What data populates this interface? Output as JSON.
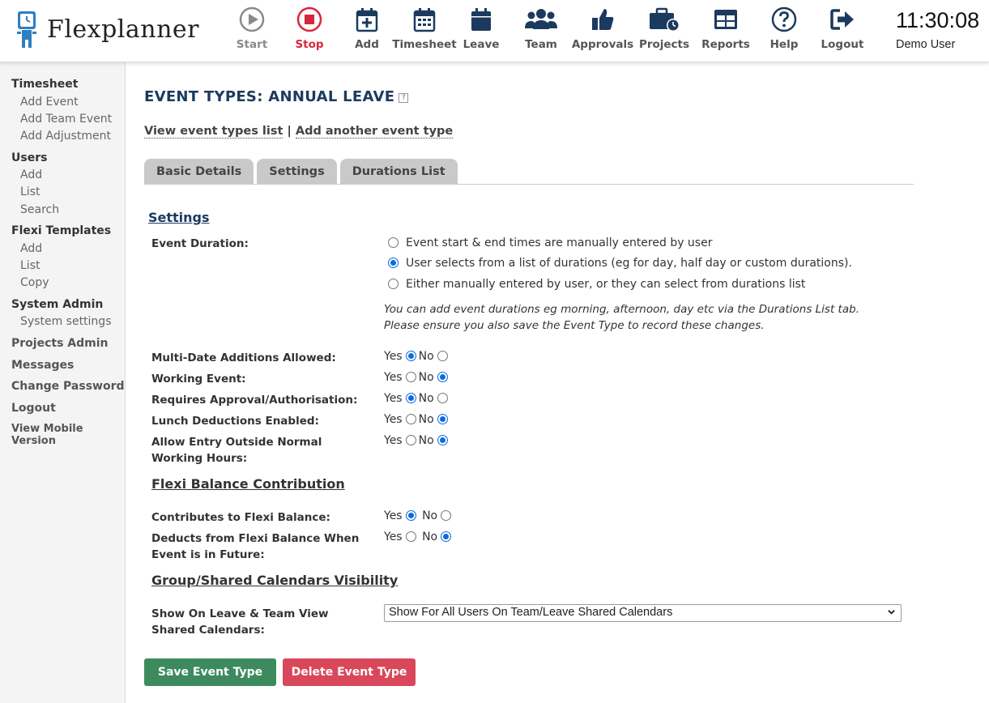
{
  "app": {
    "name": "Flexplanner"
  },
  "nav": [
    {
      "label": "Start",
      "icon": "play-circle-icon"
    },
    {
      "label": "Stop",
      "icon": "stop-circle-icon"
    },
    {
      "label": "Add",
      "icon": "calendar-plus-icon"
    },
    {
      "label": "Timesheet",
      "icon": "calendar-grid-icon"
    },
    {
      "label": "Leave",
      "icon": "calendar-icon"
    },
    {
      "label": "Team",
      "icon": "team-icon"
    },
    {
      "label": "Approvals",
      "icon": "thumbs-up-icon"
    },
    {
      "label": "Projects",
      "icon": "briefcase-clock-icon"
    },
    {
      "label": "Reports",
      "icon": "table-icon"
    },
    {
      "label": "Help",
      "icon": "help-circle-icon"
    },
    {
      "label": "Logout",
      "icon": "logout-icon"
    }
  ],
  "clock": "11:30:08",
  "user": "Demo User",
  "sidebar": {
    "timesheet": "Timesheet",
    "add_event": "Add Event",
    "add_team_event": "Add Team Event",
    "add_adjustment": "Add Adjustment",
    "users": "Users",
    "users_add": "Add",
    "users_list": "List",
    "users_search": "Search",
    "flexi_templates": "Flexi Templates",
    "ft_add": "Add",
    "ft_list": "List",
    "ft_copy": "Copy",
    "system_admin": "System Admin",
    "system_settings": "System settings",
    "projects_admin": "Projects Admin",
    "messages": "Messages",
    "change_password": "Change Password",
    "logout": "Logout",
    "mobile": "View Mobile Version"
  },
  "page": {
    "title": "EVENT TYPES: ANNUAL LEAVE",
    "help_glyph": "?",
    "link_list": "View event types list",
    "link_sep": "|",
    "link_add": "Add another event type",
    "tabs": [
      "Basic Details",
      "Settings",
      "Durations List"
    ]
  },
  "settings": {
    "title": "Settings",
    "event_duration_label": "Event Duration:",
    "duration_options": [
      "Event start & end times are manually entered by user",
      "User selects from a list of durations (eg for day, half day or custom durations).",
      "Either manually entered by user, or they can select from durations list"
    ],
    "duration_selected": 1,
    "note_line1": "You can add event durations eg morning, afternoon, day etc via the Durations List tab.",
    "note_line2": "Please ensure you also save the Event Type to record these changes.",
    "yes": "Yes",
    "no": "No",
    "rows": [
      {
        "label": "Multi-Date Additions Allowed:",
        "value": "Yes"
      },
      {
        "label": "Working Event:",
        "value": "No"
      },
      {
        "label": "Requires Approval/Authorisation:",
        "value": "Yes"
      },
      {
        "label": "Lunch Deductions Enabled:",
        "value": "No"
      },
      {
        "label_line1": "Allow Entry Outside Normal",
        "label_line2": "Working Hours:",
        "value": "No"
      }
    ]
  },
  "flexi": {
    "title": "Flexi Balance Contribution",
    "contributes_label": "Contributes to Flexi Balance:",
    "contributes_value": "Yes",
    "deducts_line1": "Deducts from Flexi Balance When",
    "deducts_line2": "Event is in Future:",
    "deducts_value": "No"
  },
  "calendars": {
    "title": "Group/Shared Calendars Visibility",
    "label_line1": "Show On Leave & Team View",
    "label_line2": "Shared Calendars:",
    "selected": "Show For All Users On Team/Leave Shared Calendars"
  },
  "buttons": {
    "save": "Save Event Type",
    "delete": "Delete Event Type"
  },
  "colors": {
    "brand_navy": "#1c3a5f",
    "stop_red": "#d9263c",
    "save_green": "#3d8a5f",
    "delete_red": "#d9475b",
    "radio_blue": "#0b6cdc"
  }
}
